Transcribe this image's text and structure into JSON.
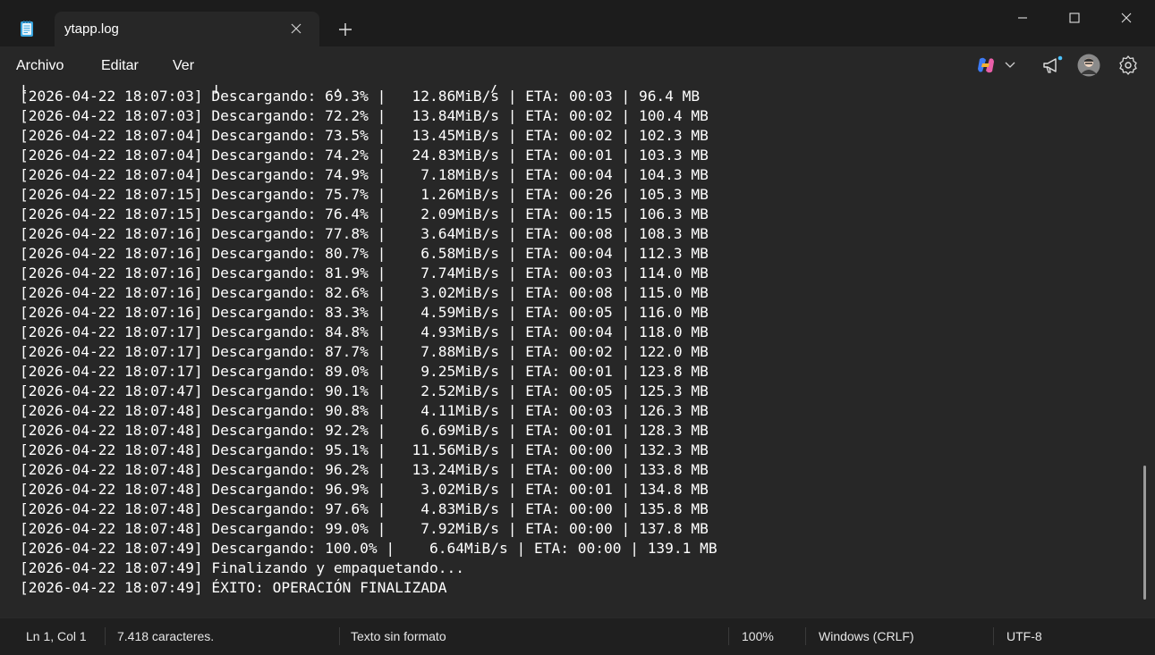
{
  "tab": {
    "title": "ytapp.log"
  },
  "menu": {
    "file": "Archivo",
    "edit": "Editar",
    "view": "Ver"
  },
  "log_lines": [
    "[2026-04-22 18:07:03] Descargando: 69.3% |   12.86MiB/s | ETA: 00:03 | 96.4 MB",
    "[2026-04-22 18:07:03] Descargando: 72.2% |   13.84MiB/s | ETA: 00:02 | 100.4 MB",
    "[2026-04-22 18:07:04] Descargando: 73.5% |   13.45MiB/s | ETA: 00:02 | 102.3 MB",
    "[2026-04-22 18:07:04] Descargando: 74.2% |   24.83MiB/s | ETA: 00:01 | 103.3 MB",
    "[2026-04-22 18:07:04] Descargando: 74.9% |    7.18MiB/s | ETA: 00:04 | 104.3 MB",
    "[2026-04-22 18:07:15] Descargando: 75.7% |    1.26MiB/s | ETA: 00:26 | 105.3 MB",
    "[2026-04-22 18:07:15] Descargando: 76.4% |    2.09MiB/s | ETA: 00:15 | 106.3 MB",
    "[2026-04-22 18:07:16] Descargando: 77.8% |    3.64MiB/s | ETA: 00:08 | 108.3 MB",
    "[2026-04-22 18:07:16] Descargando: 80.7% |    6.58MiB/s | ETA: 00:04 | 112.3 MB",
    "[2026-04-22 18:07:16] Descargando: 81.9% |    7.74MiB/s | ETA: 00:03 | 114.0 MB",
    "[2026-04-22 18:07:16] Descargando: 82.6% |    3.02MiB/s | ETA: 00:08 | 115.0 MB",
    "[2026-04-22 18:07:16] Descargando: 83.3% |    4.59MiB/s | ETA: 00:05 | 116.0 MB",
    "[2026-04-22 18:07:17] Descargando: 84.8% |    4.93MiB/s | ETA: 00:04 | 118.0 MB",
    "[2026-04-22 18:07:17] Descargando: 87.7% |    7.88MiB/s | ETA: 00:02 | 122.0 MB",
    "[2026-04-22 18:07:17] Descargando: 89.0% |    9.25MiB/s | ETA: 00:01 | 123.8 MB",
    "[2026-04-22 18:07:47] Descargando: 90.1% |    2.52MiB/s | ETA: 00:05 | 125.3 MB",
    "[2026-04-22 18:07:48] Descargando: 90.8% |    4.11MiB/s | ETA: 00:03 | 126.3 MB",
    "[2026-04-22 18:07:48] Descargando: 92.2% |    6.69MiB/s | ETA: 00:01 | 128.3 MB",
    "[2026-04-22 18:07:48] Descargando: 95.1% |   11.56MiB/s | ETA: 00:00 | 132.3 MB",
    "[2026-04-22 18:07:48] Descargando: 96.2% |   13.24MiB/s | ETA: 00:00 | 133.8 MB",
    "[2026-04-22 18:07:48] Descargando: 96.9% |    3.02MiB/s | ETA: 00:01 | 134.8 MB",
    "[2026-04-22 18:07:48] Descargando: 97.6% |    4.83MiB/s | ETA: 00:00 | 135.8 MB",
    "[2026-04-22 18:07:48] Descargando: 99.0% |    7.92MiB/s | ETA: 00:00 | 137.8 MB",
    "[2026-04-22 18:07:49] Descargando: 100.0% |    6.64MiB/s | ETA: 00:00 | 139.1 MB",
    "[2026-04-22 18:07:49] Finalizando y empaquetando...",
    "[2026-04-22 18:07:49] ÉXITO: OPERACIÓN FINALIZADA"
  ],
  "status": {
    "position": "Ln 1, Col 1",
    "characters": "7.418 caracteres.",
    "format": "Texto sin formato",
    "zoom": "100%",
    "line_ending": "Windows (CRLF)",
    "encoding": "UTF-8"
  },
  "icons": {
    "app": "notepad-icon",
    "tab_close": "close-icon",
    "new_tab": "plus-icon",
    "copilot": "copilot-icon",
    "copilot_menu": "chevron-down-icon",
    "announcements": "megaphone-icon",
    "account": "avatar",
    "settings": "gear-icon",
    "minimize": "minimize-icon",
    "maximize": "maximize-icon",
    "close": "close-icon"
  },
  "colors": {
    "titlebar": "#1c1c1c",
    "editor_background": "#272727",
    "statusbar": "#1f1f1f",
    "text": "#ffffff",
    "notification_dot": "#4cc2ff"
  }
}
